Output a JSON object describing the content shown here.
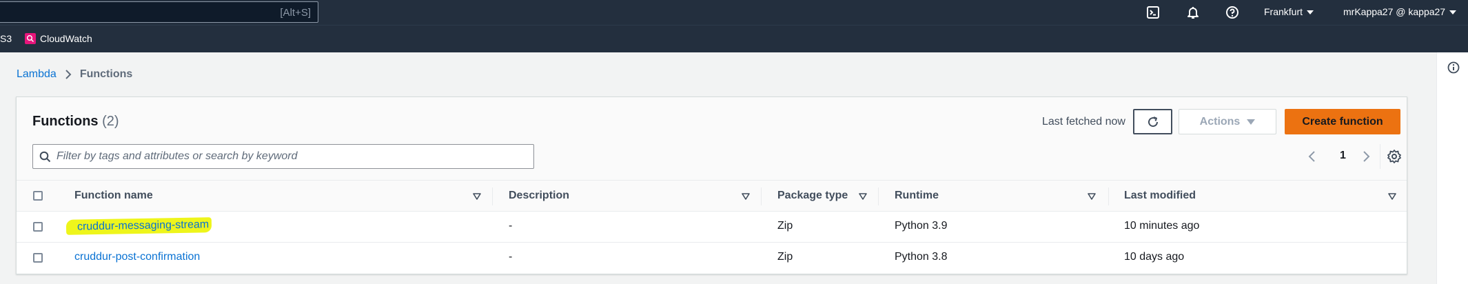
{
  "topnav": {
    "search_shortcut": "[Alt+S]",
    "region": "Frankfurt",
    "account": "mrKappa27 @ kappa27"
  },
  "favorites": [
    {
      "label": "S3"
    },
    {
      "label": "CloudWatch"
    }
  ],
  "breadcrumb": {
    "root": "Lambda",
    "current": "Functions"
  },
  "functions_panel": {
    "title": "Functions",
    "count": "(2)",
    "last_fetched": "Last fetched now",
    "actions_label": "Actions",
    "create_label": "Create function",
    "filter_placeholder": "Filter by tags and attributes or search by keyword",
    "page": "1"
  },
  "table": {
    "columns": [
      "Function name",
      "Description",
      "Package type",
      "Runtime",
      "Last modified"
    ],
    "rows": [
      {
        "name": "cruddur-messaging-stream",
        "description": "-",
        "package_type": "Zip",
        "runtime": "Python 3.9",
        "last_modified": "10 minutes ago",
        "highlighted": true
      },
      {
        "name": "cruddur-post-confirmation",
        "description": "-",
        "package_type": "Zip",
        "runtime": "Python 3.8",
        "last_modified": "10 days ago",
        "highlighted": false
      }
    ]
  },
  "colors": {
    "nav_bg": "#232f3e",
    "link": "#0972d3",
    "primary_button": "#ec7211",
    "highlight": "#eef51b",
    "cloudwatch_icon": "#e7157b"
  }
}
